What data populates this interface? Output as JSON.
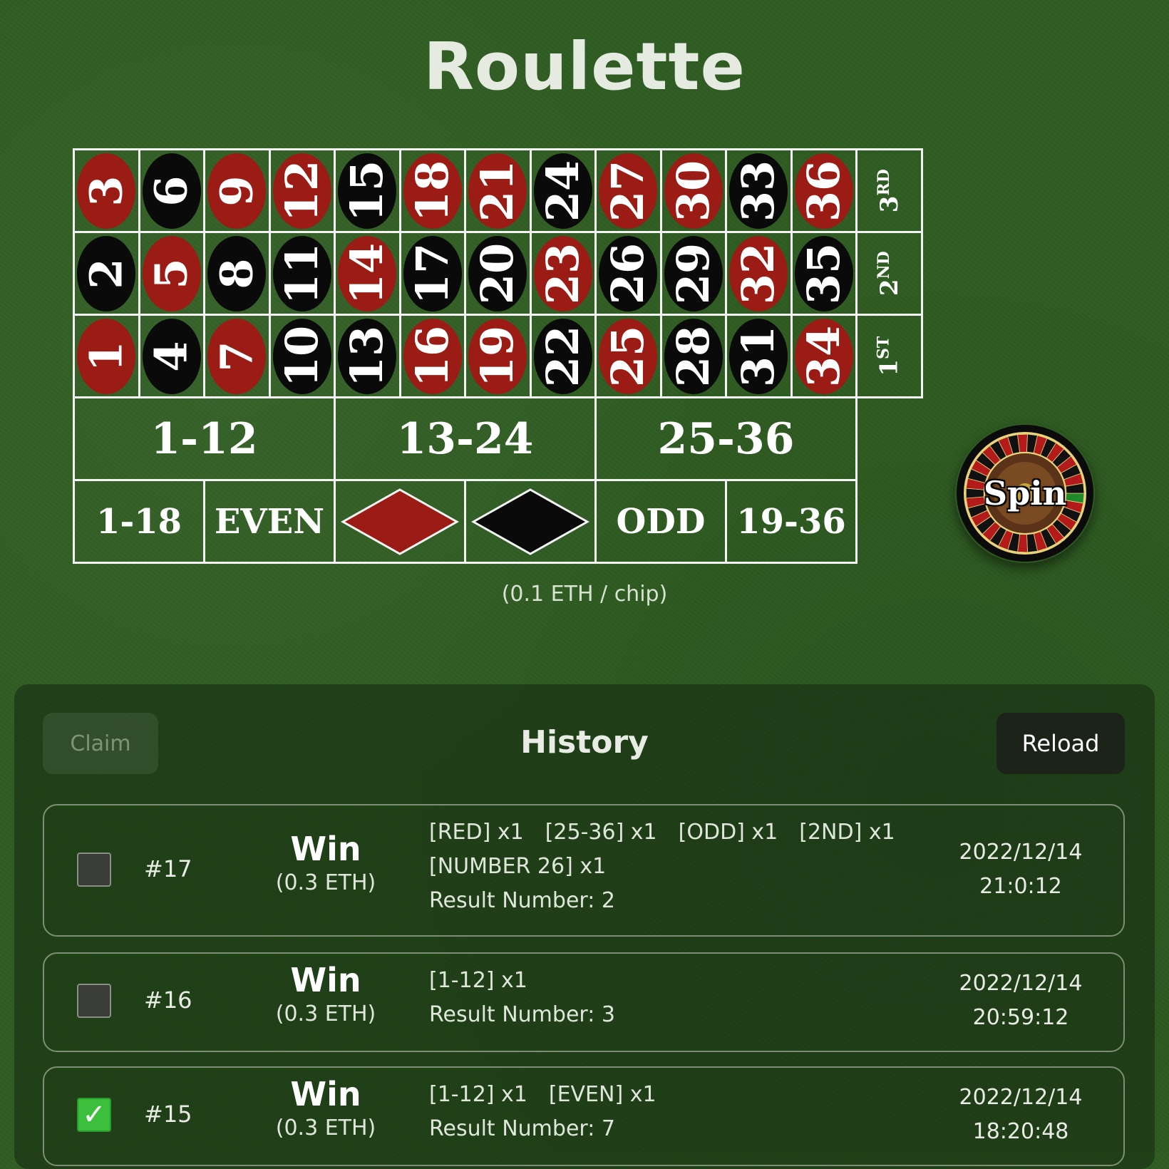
{
  "title": "Roulette",
  "board": {
    "rows": [
      [
        {
          "n": "3",
          "c": "red"
        },
        {
          "n": "6",
          "c": "black"
        },
        {
          "n": "9",
          "c": "red"
        },
        {
          "n": "12",
          "c": "red"
        },
        {
          "n": "15",
          "c": "black"
        },
        {
          "n": "18",
          "c": "red"
        },
        {
          "n": "21",
          "c": "red"
        },
        {
          "n": "24",
          "c": "black"
        },
        {
          "n": "27",
          "c": "red"
        },
        {
          "n": "30",
          "c": "red"
        },
        {
          "n": "33",
          "c": "black"
        },
        {
          "n": "36",
          "c": "red"
        }
      ],
      [
        {
          "n": "2",
          "c": "black"
        },
        {
          "n": "5",
          "c": "red"
        },
        {
          "n": "8",
          "c": "black"
        },
        {
          "n": "11",
          "c": "black"
        },
        {
          "n": "14",
          "c": "red"
        },
        {
          "n": "17",
          "c": "black"
        },
        {
          "n": "20",
          "c": "black"
        },
        {
          "n": "23",
          "c": "red"
        },
        {
          "n": "26",
          "c": "black"
        },
        {
          "n": "29",
          "c": "black"
        },
        {
          "n": "32",
          "c": "red"
        },
        {
          "n": "35",
          "c": "black"
        }
      ],
      [
        {
          "n": "1",
          "c": "red"
        },
        {
          "n": "4",
          "c": "black"
        },
        {
          "n": "7",
          "c": "red"
        },
        {
          "n": "10",
          "c": "black"
        },
        {
          "n": "13",
          "c": "black"
        },
        {
          "n": "16",
          "c": "red"
        },
        {
          "n": "19",
          "c": "red"
        },
        {
          "n": "22",
          "c": "black"
        },
        {
          "n": "25",
          "c": "red"
        },
        {
          "n": "28",
          "c": "black"
        },
        {
          "n": "31",
          "c": "black"
        },
        {
          "n": "34",
          "c": "red"
        }
      ]
    ],
    "columns": [
      {
        "num": "3",
        "suffix": "RD"
      },
      {
        "num": "2",
        "suffix": "ND"
      },
      {
        "num": "1",
        "suffix": "ST"
      }
    ],
    "dozens": [
      "1-12",
      "13-24",
      "25-36"
    ],
    "outside": {
      "low": "1-18",
      "even": "EVEN",
      "odd": "ODD",
      "high": "19-36"
    },
    "colors": {
      "red": "#9b1b15",
      "black": "#0a0a0a",
      "line": "#f4f4f4"
    }
  },
  "chip_note": "(0.1 ETH / chip)",
  "spin": {
    "label": "Spin"
  },
  "history": {
    "title": "History",
    "claim_label": "Claim",
    "reload_label": "Reload",
    "rows": [
      {
        "id": "#17",
        "result": "Win",
        "amount": "(0.3 ETH)",
        "bets_line1": [
          "[RED] x1",
          "[25-36] x1",
          "[ODD] x1",
          "[2ND] x1"
        ],
        "bets_line2": [
          "[NUMBER 26] x1"
        ],
        "result_number": "Result Number: 2",
        "date": "2022/12/14",
        "time": "21:0:12",
        "checked": false
      },
      {
        "id": "#16",
        "result": "Win",
        "amount": "(0.3 ETH)",
        "bets_line1": [
          "[1-12] x1"
        ],
        "bets_line2": [],
        "result_number": "Result Number: 3",
        "date": "2022/12/14",
        "time": "20:59:12",
        "checked": false
      },
      {
        "id": "#15",
        "result": "Win",
        "amount": "(0.3 ETH)",
        "bets_line1": [
          "[1-12] x1",
          "[EVEN] x1"
        ],
        "bets_line2": [],
        "result_number": "Result Number: 7",
        "date": "2022/12/14",
        "time": "18:20:48",
        "checked": true
      }
    ]
  }
}
